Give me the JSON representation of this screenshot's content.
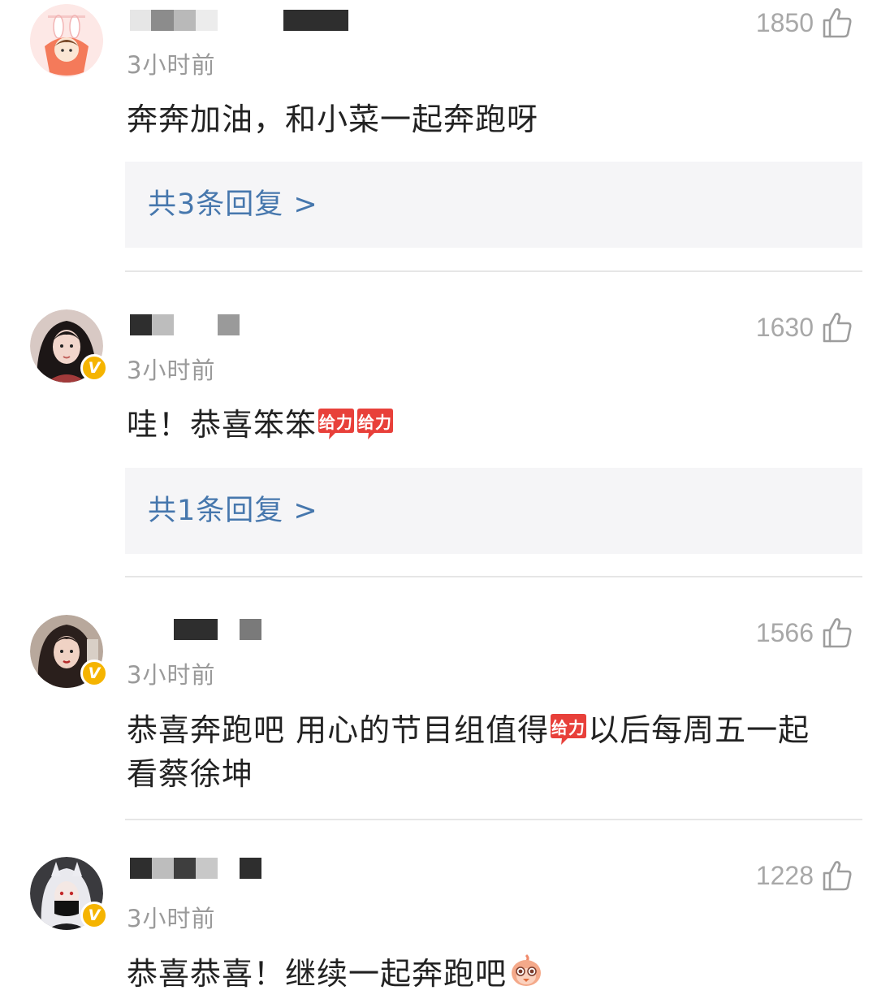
{
  "comments": [
    {
      "time": "3小时前",
      "likes": "1850",
      "text": "奔奔加油，和小菜一起奔跑呀",
      "reply_link": "共3条回复 >",
      "verified": false
    },
    {
      "time": "3小时前",
      "likes": "1630",
      "text": "哇！恭喜笨笨",
      "reply_link": "共1条回复 >",
      "verified": true
    },
    {
      "time": "3小时前",
      "likes": "1566",
      "text_line1_a": "恭喜奔跑吧 用心的节目组值得",
      "text_line1_b": "以后每周五一起",
      "text_line2": "看蔡徐坤",
      "verified": true
    },
    {
      "time": "3小时前",
      "likes": "1228",
      "text": "恭喜恭喜！继续一起奔跑吧",
      "verified": true
    }
  ],
  "emoji": {
    "gift_label": "给力"
  },
  "badge": {
    "verified_label": "V"
  },
  "colors": {
    "link": "#4677ad",
    "reply_bg": "#f5f5f7",
    "time": "#9a9a9a",
    "likes": "#a8a8a8",
    "badge": "#f5b400",
    "emoji_red": "#e8403a"
  },
  "icons": {
    "like": "thumbs-up-outline-icon",
    "verified": "verified-v-badge-icon",
    "emoji_geili": "geili-red-bubble-emoji",
    "emoji_bird": "bird-face-emoji"
  }
}
